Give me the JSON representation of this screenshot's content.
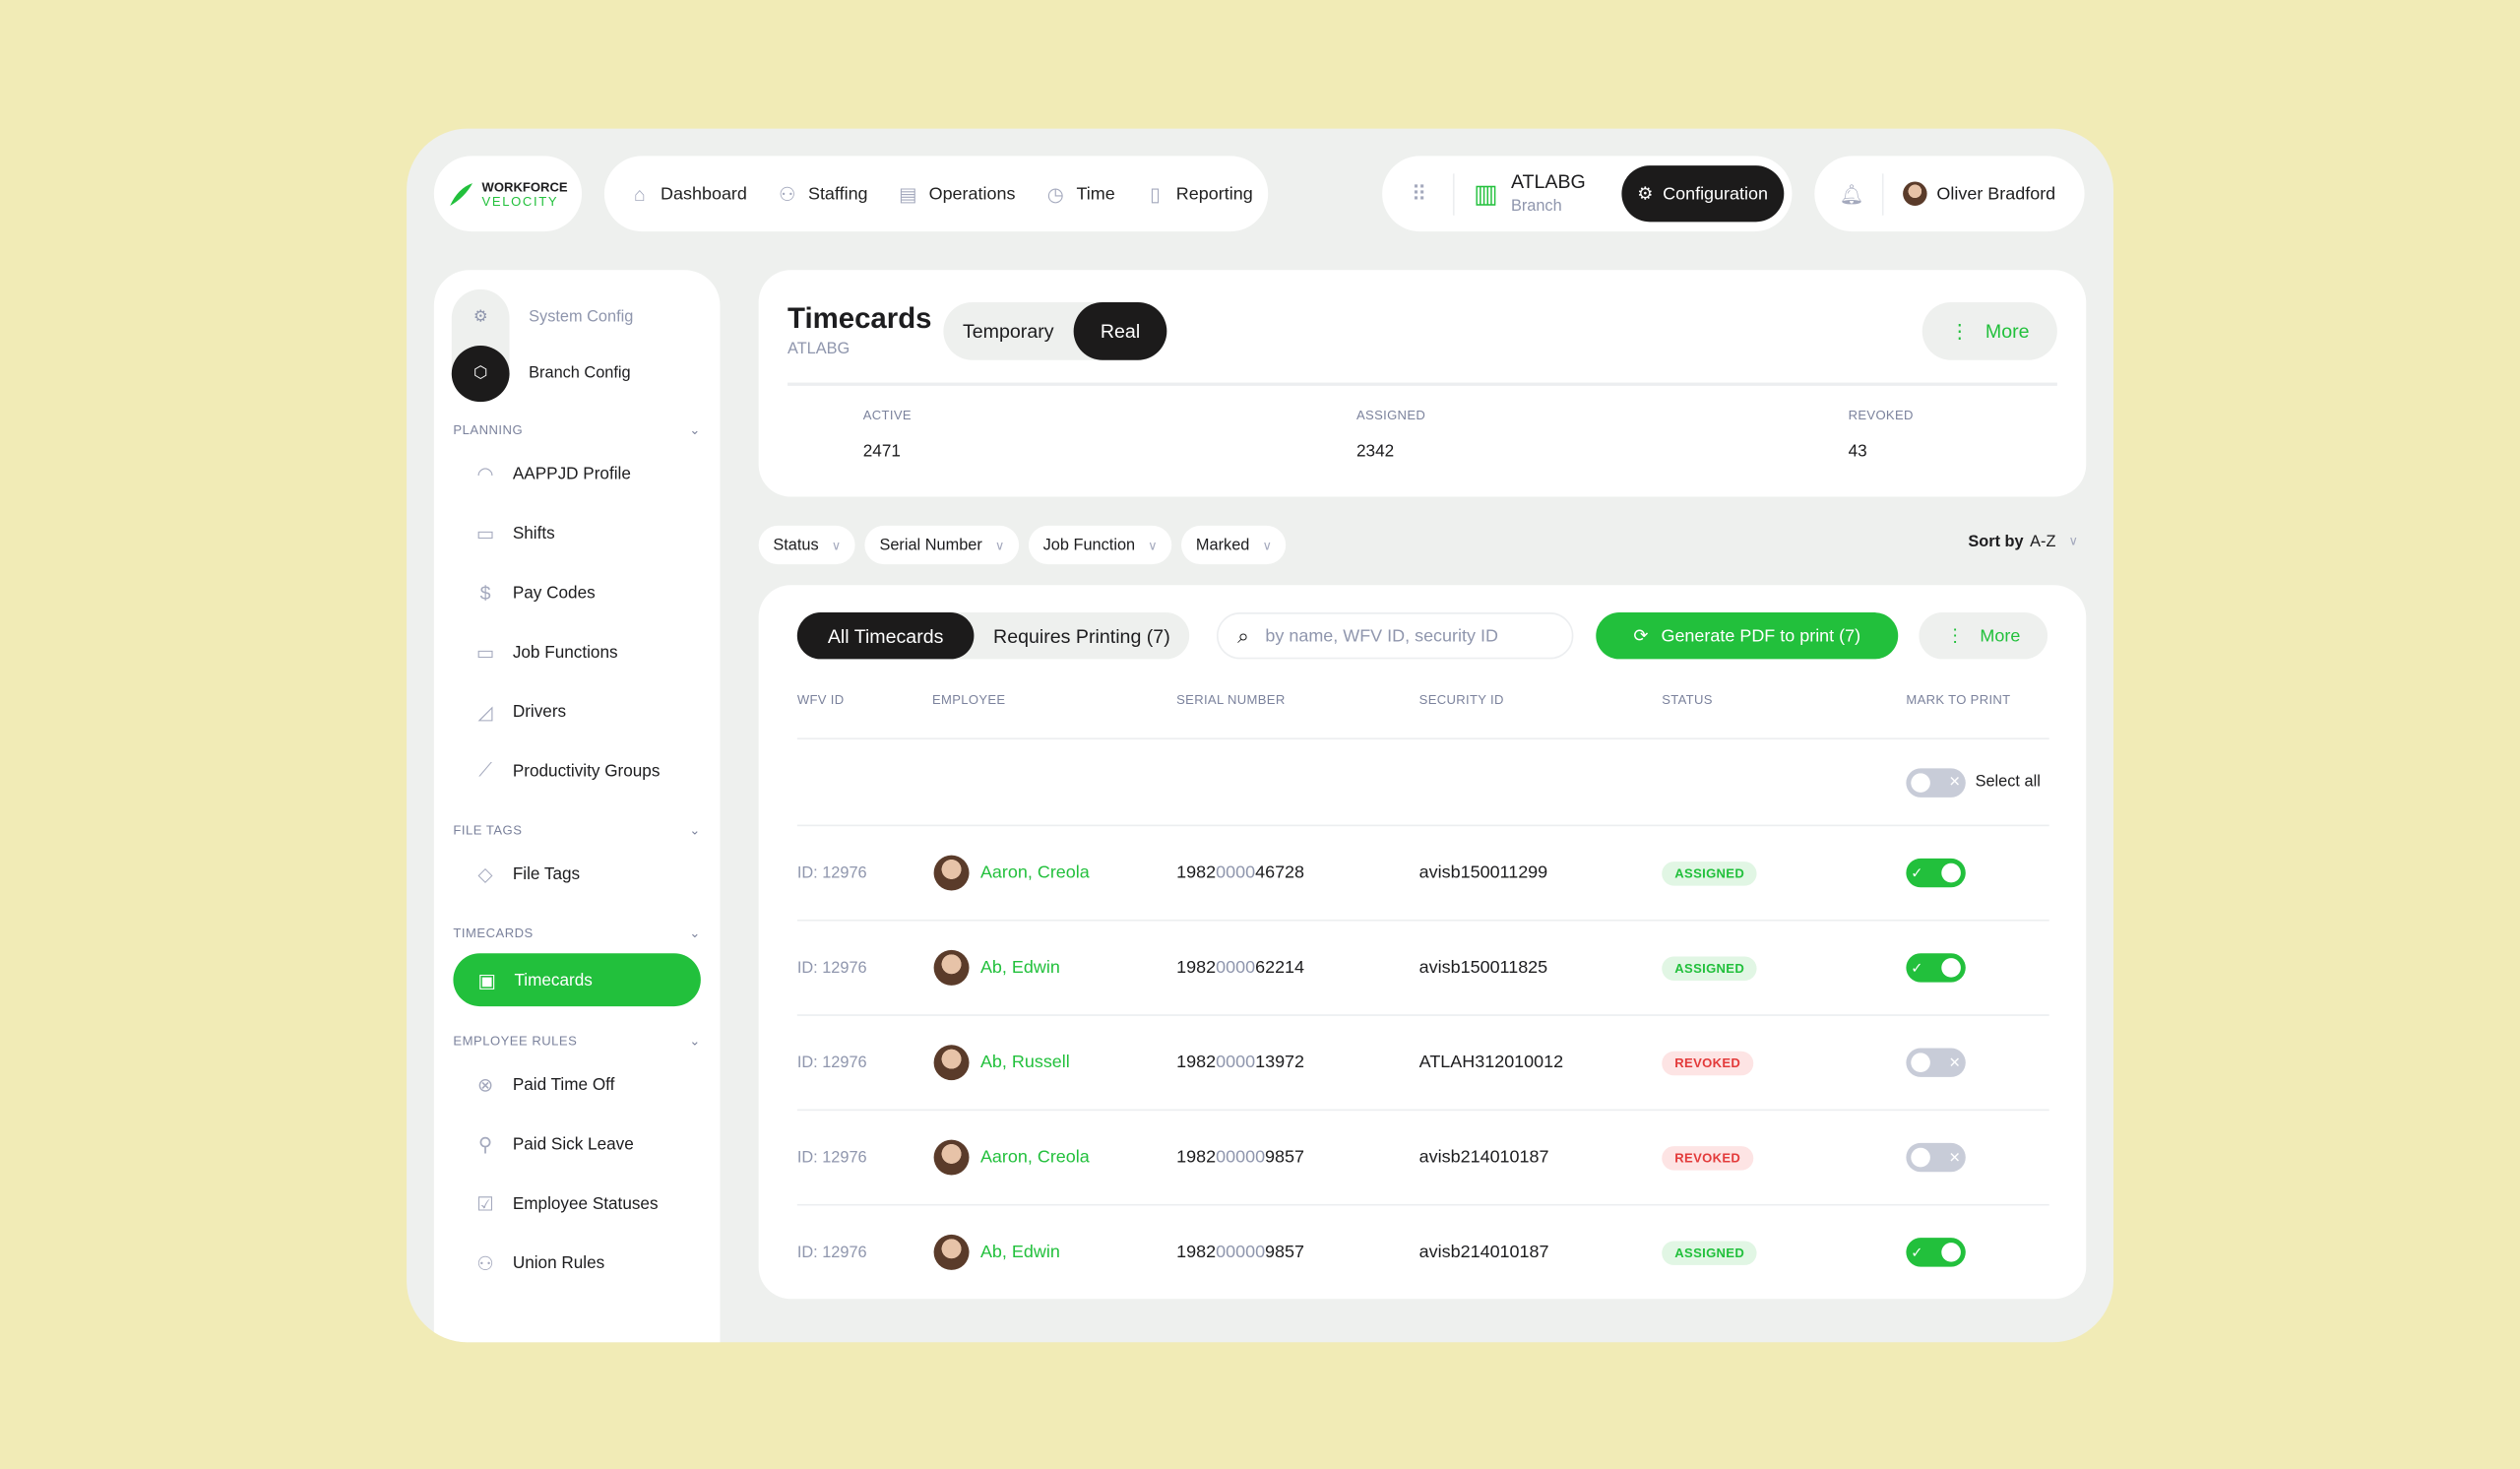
{
  "brand": {
    "line1": "WORKFORCE",
    "line2": "VELOCITY"
  },
  "nav": [
    {
      "label": "Dashboard",
      "icon": "home-icon"
    },
    {
      "label": "Staffing",
      "icon": "users-icon"
    },
    {
      "label": "Operations",
      "icon": "calendar-icon"
    },
    {
      "label": "Time",
      "icon": "clock-icon"
    },
    {
      "label": "Reporting",
      "icon": "document-icon"
    }
  ],
  "branch": {
    "name": "ATLABG",
    "sub": "Branch"
  },
  "config_label": "Configuration",
  "user": {
    "name": "Oliver Bradford"
  },
  "sidebar": {
    "system_config": "System Config",
    "branch_config": "Branch Config",
    "sections": [
      {
        "title": "PLANNING",
        "items": [
          "AAPPJD Profile",
          "Shifts",
          "Pay Codes",
          "Job Functions",
          "Drivers",
          "Productivity Groups"
        ]
      },
      {
        "title": "FILE TAGS",
        "items": [
          "File Tags"
        ]
      },
      {
        "title": "TIMECARDS",
        "items": [
          "Timecards"
        ]
      },
      {
        "title": "EMPLOYEE RULES",
        "items": [
          "Paid Time Off",
          "Paid Sick Leave",
          "Employee Statuses",
          "Union Rules"
        ]
      }
    ]
  },
  "header": {
    "title": "Timecards",
    "subtitle": "ATLABG",
    "seg": [
      "Temporary",
      "Real"
    ],
    "selected": "Real",
    "more": "More",
    "stats": [
      {
        "label": "ACTIVE",
        "value": "2471"
      },
      {
        "label": "ASSIGNED",
        "value": "2342"
      },
      {
        "label": "REVOKED",
        "value": "43"
      }
    ]
  },
  "filters": [
    "Status",
    "Serial Number",
    "Job Function",
    "Marked"
  ],
  "sort": {
    "prefix": "Sort by",
    "value": "A-Z"
  },
  "table": {
    "tabs": [
      "All Timecards",
      "Requires Printing (7)"
    ],
    "search_placeholder": "by name, WFV ID, security ID",
    "generate": "Generate PDF to print (7)",
    "more": "More",
    "columns": [
      "WFV ID",
      "EMPLOYEE",
      "SERIAL NUMBER",
      "SECURITY ID",
      "STATUS",
      "MARK TO PRINT"
    ],
    "select_all": "Select all",
    "rows": [
      {
        "id": "ID: 12976",
        "name": "Aaron, Creola",
        "serial": [
          "1982",
          "0000",
          "46728"
        ],
        "security": "avisb150011299",
        "status": "ASSIGNED",
        "marked": true
      },
      {
        "id": "ID: 12976",
        "name": "Ab, Edwin",
        "serial": [
          "1982",
          "0000",
          "62214"
        ],
        "security": "avisb150011825",
        "status": "ASSIGNED",
        "marked": true
      },
      {
        "id": "ID: 12976",
        "name": "Ab, Russell",
        "serial": [
          "1982",
          "0000",
          "13972"
        ],
        "security": "ATLAH312010012",
        "status": "REVOKED",
        "marked": false
      },
      {
        "id": "ID: 12976",
        "name": "Aaron, Creola",
        "serial": [
          "1982",
          "00000",
          "9857"
        ],
        "security": "avisb214010187",
        "status": "REVOKED",
        "marked": false
      },
      {
        "id": "ID: 12976",
        "name": "Ab, Edwin",
        "serial": [
          "1982",
          "00000",
          "9857"
        ],
        "security": "avisb214010187",
        "status": "ASSIGNED",
        "marked": true
      }
    ]
  },
  "colors": {
    "accent": "#22c03c",
    "dark": "#1c1b1b",
    "background": "#f1ebb6",
    "revoked": "#e33b3b"
  }
}
